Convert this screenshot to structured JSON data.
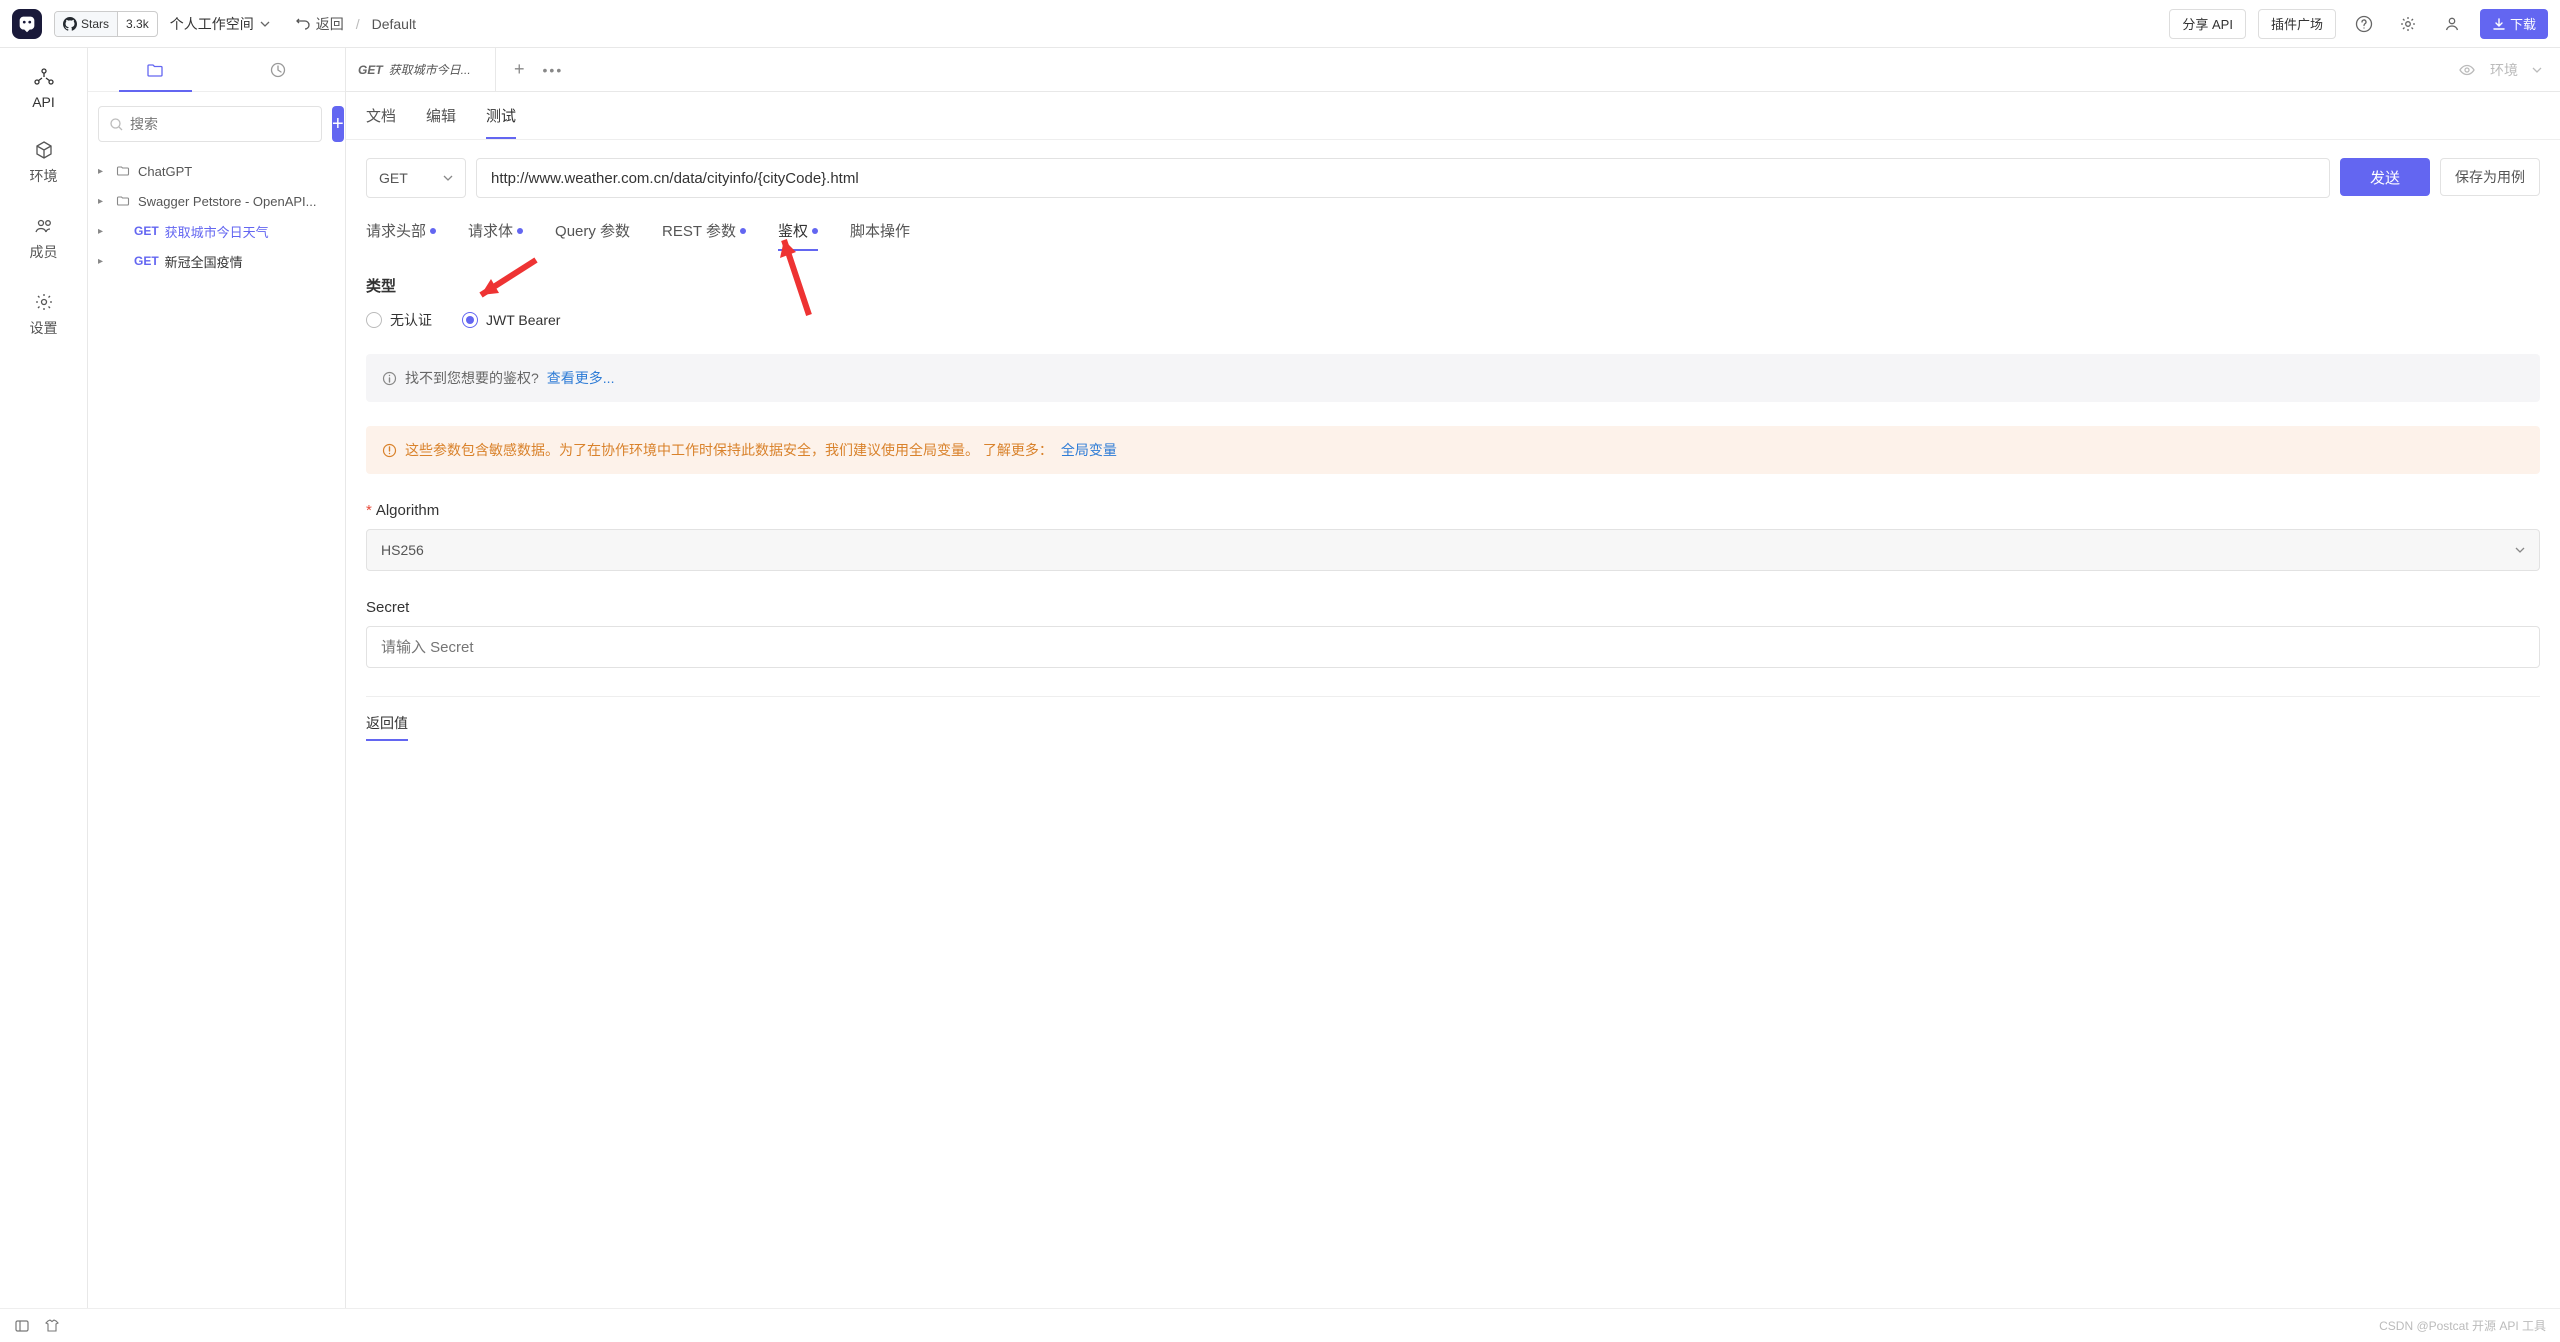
{
  "topbar": {
    "gh_label": "Stars",
    "gh_count": "3.3k",
    "workspace": "个人工作空间",
    "back": "返回",
    "crumb": "Default",
    "share_api": "分享 API",
    "plugin_market": "插件广场",
    "download": "下载"
  },
  "rail": {
    "api": "API",
    "env": "环境",
    "members": "成员",
    "settings": "设置"
  },
  "sidebar": {
    "search_placeholder": "搜索",
    "tree": {
      "f0": "ChatGPT",
      "f1": "Swagger Petstore - OpenAPI...",
      "i0_method": "GET",
      "i0_name": "获取城市今日天气",
      "i1_method": "GET",
      "i1_name": "新冠全国疫情"
    }
  },
  "tab": {
    "method": "GET",
    "title": "获取城市今日..."
  },
  "env": {
    "label": "环境"
  },
  "modes": {
    "doc": "文档",
    "edit": "编辑",
    "test": "测试"
  },
  "urlrow": {
    "method": "GET",
    "url": "http://www.weather.com.cn/data/cityinfo/{cityCode}.html",
    "send": "发送",
    "save": "保存为用例"
  },
  "reqtabs": {
    "headers": "请求头部",
    "body": "请求体",
    "query": "Query 参数",
    "rest": "REST 参数",
    "auth": "鉴权",
    "script": "脚本操作"
  },
  "auth": {
    "type_label": "类型",
    "none": "无认证",
    "jwt": "JWT Bearer",
    "info_text": "找不到您想要的鉴权?",
    "info_link": "查看更多...",
    "warn_text": "这些参数包含敏感数据。为了在协作环境中工作时保持此数据安全，我们建议使用全局变量。 了解更多：",
    "warn_link": "全局变量",
    "algorithm_label": "Algorithm",
    "algorithm_value": "HS256",
    "secret_label": "Secret",
    "secret_placeholder": "请输入 Secret",
    "return_label": "返回值"
  },
  "footer": {
    "watermark": "CSDN @Postcat 开源 API 工具"
  }
}
